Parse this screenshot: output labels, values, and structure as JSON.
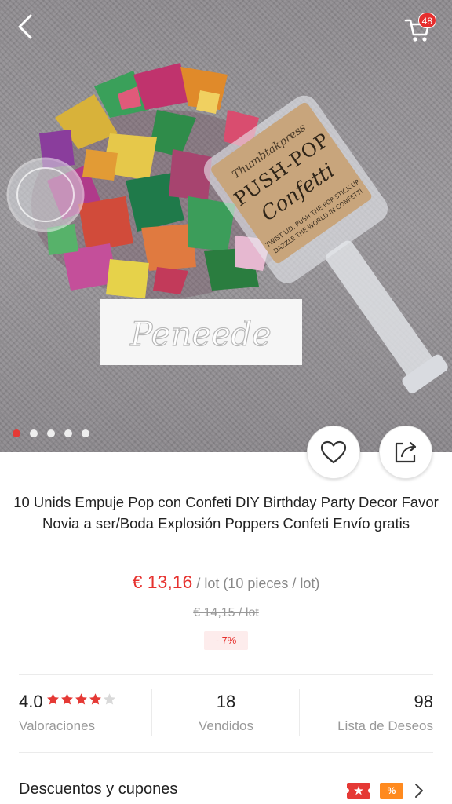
{
  "header": {
    "back_icon": "chevron-left-icon",
    "cart_icon": "cart-icon",
    "cart_count": "48"
  },
  "gallery": {
    "image_count": 5,
    "active_index": 0,
    "watermark": "Peneede",
    "label_brand": "Thumbtakpress",
    "label_title": "PUSH-POP",
    "label_subtitle": "Confetti",
    "label_small_1": "TWIST LID, PUSH THE POP STICK UP",
    "label_small_2": "DAZZLE THE WORLD IN CONFETTI"
  },
  "actions": {
    "favorite_icon": "heart-icon",
    "share_icon": "share-icon"
  },
  "product": {
    "title": "10 Unids Empuje Pop con Confeti DIY Birthday Party Decor Favor Novia a ser/Boda Explosión Poppers Confeti Envío gratis",
    "price": "€ 13,16",
    "price_unit": " / lot (10 pieces / lot)",
    "old_price": "€ 14,15  / lot",
    "discount": "- 7%"
  },
  "stats": {
    "rating": "4.0",
    "rating_value": 4,
    "rating_max": 5,
    "rating_label": "Valoraciones",
    "sold": "18",
    "sold_label": "Vendidos",
    "wishlist": "98",
    "wishlist_label": "Lista de Deseos"
  },
  "coupons": {
    "label": "Descuentos y cupones",
    "icon_1": "store-coupon-icon",
    "icon_2": "percent-icon",
    "icon_2_text": "%",
    "chevron_icon": "chevron-right-icon"
  },
  "colors": {
    "accent": "#e6312e",
    "discount_bg": "#fdecec",
    "muted_text": "#999999",
    "star_filled": "#e53935",
    "star_empty": "#d9d9d9"
  }
}
